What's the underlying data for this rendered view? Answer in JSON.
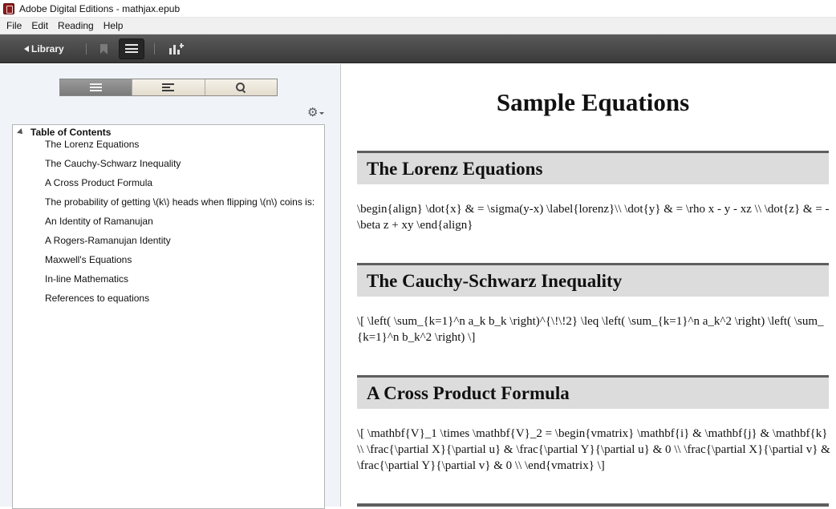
{
  "window": {
    "title": "Adobe Digital Editions - mathjax.epub"
  },
  "menu": [
    "File",
    "Edit",
    "Reading",
    "Help"
  ],
  "toolbar": {
    "library_label": "Library"
  },
  "toc": {
    "header": "Table of Contents",
    "items": [
      "The Lorenz Equations",
      "The Cauchy-Schwarz Inequality",
      "A Cross Product Formula",
      "The probability of getting \\(k\\) heads when flipping \\(n\\) coins is:",
      "An Identity of Ramanujan",
      "A Rogers-Ramanujan Identity",
      "Maxwell's Equations",
      "In-line Mathematics",
      "References to equations"
    ]
  },
  "document": {
    "title": "Sample Equations",
    "sections": [
      {
        "heading": "The Lorenz Equations",
        "body": "\\begin{align} \\dot{x} & = \\sigma(y-x) \\label{lorenz}\\\\ \\dot{y} & = \\rho x - y - xz \\\\ \\dot{z} & = -\\beta z + xy \\end{align}"
      },
      {
        "heading": "The Cauchy-Schwarz Inequality",
        "body": "\\[ \\left( \\sum_{k=1}^n a_k b_k \\right)^{\\!\\!2} \\leq \\left( \\sum_{k=1}^n a_k^2 \\right) \\left( \\sum_{k=1}^n b_k^2 \\right) \\]"
      },
      {
        "heading": "A Cross Product Formula",
        "body": "\\[ \\mathbf{V}_1 \\times \\mathbf{V}_2 = \\begin{vmatrix} \\mathbf{i} & \\mathbf{j} & \\mathbf{k} \\\\ \\frac{\\partial X}{\\partial u} & \\frac{\\partial Y}{\\partial u} & 0 \\\\ \\frac{\\partial X}{\\partial v} & \\frac{\\partial Y}{\\partial v} & 0 \\\\ \\end{vmatrix} \\]"
      }
    ]
  }
}
